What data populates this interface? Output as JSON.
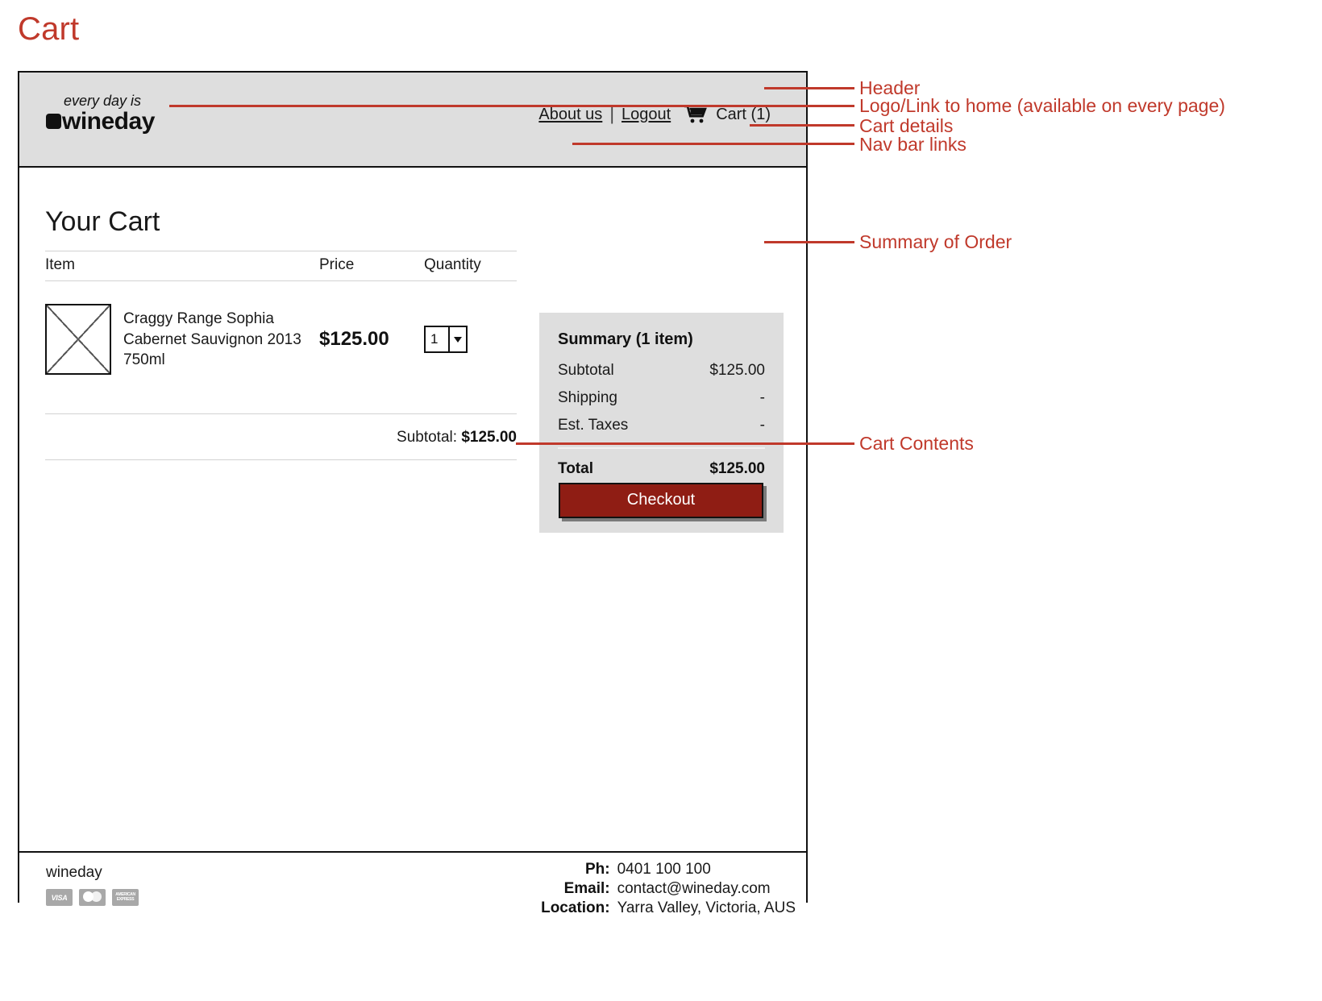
{
  "page": {
    "title": "Cart"
  },
  "header": {
    "logo": {
      "tagline": "every day is",
      "brand": "wineday",
      "mark": "square-mark-icon"
    },
    "nav": {
      "about_label": "About us",
      "separator": "|",
      "logout_label": "Logout",
      "cart_icon": "shopping-cart-icon",
      "cart_label": "Cart (1)"
    }
  },
  "cart": {
    "heading": "Your Cart",
    "columns": [
      "Item",
      "Price",
      "Quantity"
    ],
    "items": [
      {
        "thumb": "image-placeholder",
        "name": "Craggy Range Sophia Cabernet Sauvignon 2013 750ml",
        "price": "$125.00",
        "quantity": "1"
      }
    ],
    "subtotal_label": "Subtotal:",
    "subtotal_value": "$125.00"
  },
  "summary": {
    "title": "Summary (1 item)",
    "rows": [
      {
        "label": "Subtotal",
        "value": "$125.00"
      },
      {
        "label": "Shipping",
        "value": "-"
      },
      {
        "label": "Est. Taxes",
        "value": "-"
      }
    ],
    "total_label": "Total",
    "total_value": "$125.00",
    "checkout_label": "Checkout"
  },
  "footer": {
    "brand": "wineday",
    "payment_icons": [
      "VISA",
      "mastercard-icon",
      "AMERICAN EXPRESS"
    ],
    "contact": [
      {
        "label": "Ph:",
        "value": "0401 100 100"
      },
      {
        "label": "Email:",
        "value": "contact@wineday.com"
      },
      {
        "label": "Location:",
        "value": "Yarra Valley, Victoria, AUS"
      }
    ]
  },
  "annotations": [
    {
      "text": "Header"
    },
    {
      "text": "Logo/Link to home (available on every page)"
    },
    {
      "text": "Cart details"
    },
    {
      "text": "Nav bar links"
    },
    {
      "text": "Summary of Order"
    },
    {
      "text": "Cart Contents"
    }
  ],
  "colors": {
    "accent": "#c0392b",
    "header_bg": "#dedede",
    "checkout_bg": "#8f1d14",
    "frame": "#111111"
  }
}
